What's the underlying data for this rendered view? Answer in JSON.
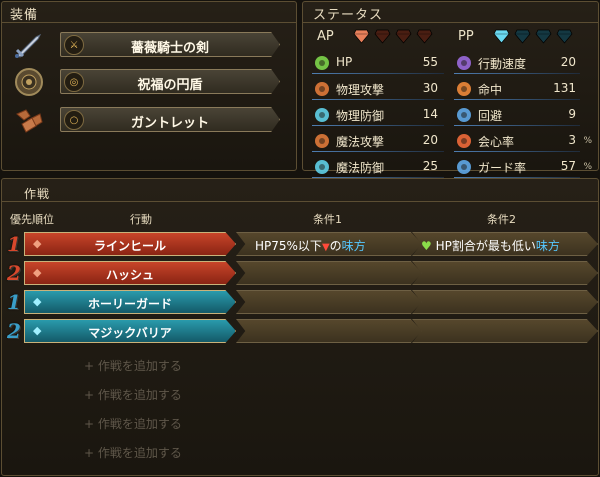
{
  "equipment": {
    "title": "装備",
    "items": [
      {
        "name": "薔薇騎士の剣",
        "icon": "sword-icon",
        "badge_icon": "sword-slot-icon"
      },
      {
        "name": "祝福の円盾",
        "icon": "round-shield-icon",
        "badge_icon": "shield-slot-icon"
      },
      {
        "name": "ガントレット",
        "icon": "gauntlet-icon",
        "badge_icon": "ring-slot-icon"
      }
    ]
  },
  "status": {
    "title": "ステータス",
    "ap_label": "AP",
    "ap_filled": 1,
    "ap_total": 4,
    "pp_label": "PP",
    "pp_filled": 1,
    "pp_total": 4,
    "left": [
      {
        "label": "HP",
        "value": "55",
        "unit": "",
        "icon": "heart-icon",
        "color": "#7dd64a"
      },
      {
        "label": "物理攻撃",
        "value": "30",
        "unit": "",
        "icon": "sword-icon",
        "color": "#e07a3a"
      },
      {
        "label": "物理防御",
        "value": "14",
        "unit": "",
        "icon": "armor-icon",
        "color": "#5fd0e8"
      },
      {
        "label": "魔法攻撃",
        "value": "20",
        "unit": "",
        "icon": "wand-icon",
        "color": "#e07a3a"
      },
      {
        "label": "魔法防御",
        "value": "25",
        "unit": "",
        "icon": "magic-shield-icon",
        "color": "#5fd0e8"
      }
    ],
    "right": [
      {
        "label": "行動速度",
        "value": "20",
        "unit": "",
        "icon": "speed-icon",
        "color": "#9a6adc"
      },
      {
        "label": "命中",
        "value": "131",
        "unit": "",
        "icon": "target-icon",
        "color": "#f08a3a"
      },
      {
        "label": "回避",
        "value": "9",
        "unit": "",
        "icon": "evade-icon",
        "color": "#5fa8e8"
      },
      {
        "label": "会心率",
        "value": "3",
        "unit": "%",
        "icon": "critical-icon",
        "color": "#f06a3a"
      },
      {
        "label": "ガード率",
        "value": "57",
        "unit": "%",
        "icon": "guard-icon",
        "color": "#5fa8e8"
      }
    ]
  },
  "tactics": {
    "title": "作戦",
    "headers": {
      "priority": "優先順位",
      "action": "行動",
      "cond1": "条件1",
      "cond2": "条件2"
    },
    "rows": [
      {
        "rank": "1",
        "action": "ラインヒール",
        "type": "ap",
        "cond1_a": "HP75%以下",
        "cond1_b": "の",
        "cond1_c": "味方",
        "cond2_a": "HP割合が最も低い",
        "cond2_b": "味方"
      },
      {
        "rank": "2",
        "action": "ハッシュ",
        "type": "ap",
        "cond1_a": "",
        "cond1_b": "",
        "cond1_c": "",
        "cond2_a": "",
        "cond2_b": ""
      },
      {
        "rank": "1",
        "action": "ホーリーガード",
        "type": "pp",
        "cond1_a": "",
        "cond1_b": "",
        "cond1_c": "",
        "cond2_a": "",
        "cond2_b": ""
      },
      {
        "rank": "2",
        "action": "マジックバリア",
        "type": "pp",
        "cond1_a": "",
        "cond1_b": "",
        "cond1_c": "",
        "cond2_a": "",
        "cond2_b": ""
      }
    ],
    "add_label": "作戦を追加する",
    "add_rows": 4
  },
  "colors": {
    "ap": "#b0341c",
    "pp": "#1f7e8e",
    "ap_rank": "#d8482c",
    "pp_rank": "#3a9ec8",
    "highlight_blue": "#56c8ff"
  }
}
